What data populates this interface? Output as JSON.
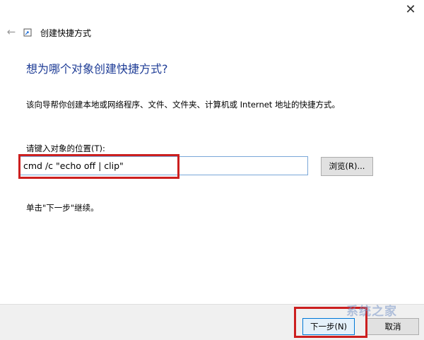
{
  "window": {
    "close_glyph": "✕"
  },
  "nav": {
    "back_glyph": "←",
    "title": "创建快捷方式"
  },
  "main": {
    "heading": "想为哪个对象创建快捷方式?",
    "description": "该向导帮你创建本地或网络程序、文件、文件夹、计算机或 Internet 地址的快捷方式。",
    "field_label": "请键入对象的位置(T):",
    "location_value": "cmd /c \"echo off | clip\"",
    "browse_label": "浏览(R)...",
    "hint": "单击\"下一步\"继续。"
  },
  "footer": {
    "next_label": "下一步(N)",
    "cancel_label": "取消"
  },
  "watermark": {
    "text": "系统之家"
  },
  "colors": {
    "heading": "#1e3c96",
    "highlight": "#cc1f1f",
    "input_border": "#7aa7d8",
    "footer_bg": "#f0f0f0"
  },
  "icons": {
    "back": "back-arrow-icon",
    "wizard": "shortcut-wizard-icon",
    "close": "close-icon"
  }
}
